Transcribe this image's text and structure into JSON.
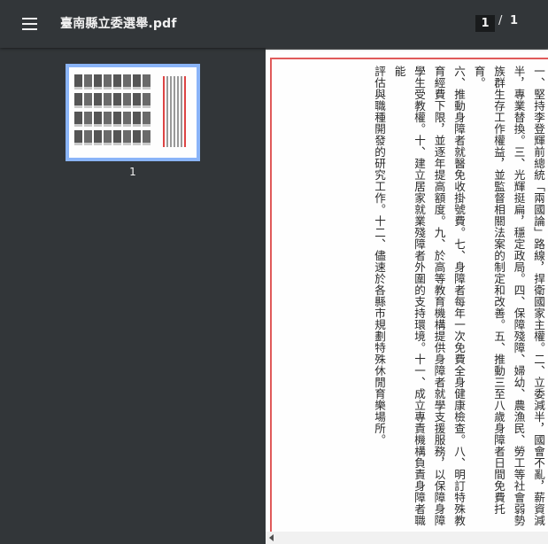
{
  "toolbar": {
    "menu_icon": "hamburger-menu-icon",
    "title": "臺南縣立委選舉.pdf",
    "current_page": "1",
    "separator": "/",
    "total_pages": "1"
  },
  "sidebar": {
    "thumbnails": [
      {
        "label": "1"
      }
    ]
  },
  "document": {
    "lines": [
      "一、堅持李登輝前總統「兩國論」路線，捍衛國家主權。二、立委減半，國會不亂，薪資減",
      "半，專業替換。三、光輝挺扁，穩定政局。四、保障殘障、婦幼、農漁民、勞工等社會弱勢",
      "族群生存工作權益，並監督相關法案的制定和改善。五、推動三至八歲身障者日間免費托育。",
      "六、推動身障者就醫免收掛號費。七、身障者每年一次免費全身健康檢查。八、明訂特殊教",
      "育經費下限，並逐年提高額度。九、於高等教育機構提供身障者就學支援服務，以保障身障",
      "學生受教權。十、建立居家就業殘障者外圍的支持環境。十一、成立專責機構負責身障者職能",
      "評估與職種開發的研究工作。十二、儘速於各縣市規劃特殊休閒育樂場所。"
    ]
  },
  "colors": {
    "toolbar_bg": "#323639",
    "viewer_bg": "#525659",
    "thumbnail_border": "#8ab4f8",
    "page_rule": "#e05a5a"
  }
}
